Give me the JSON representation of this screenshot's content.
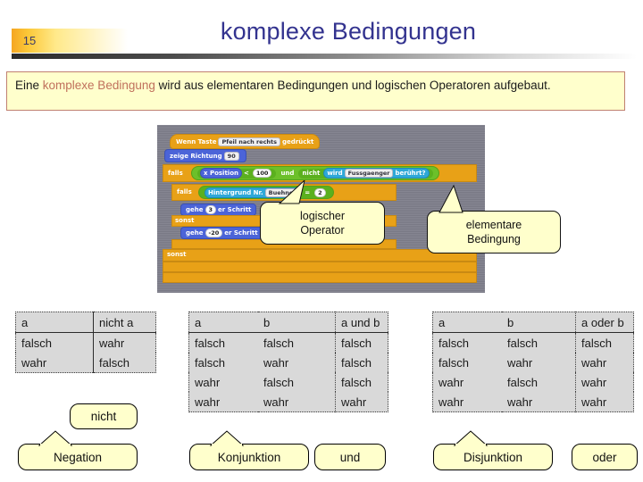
{
  "header": {
    "slide_number": "15",
    "title": "komplexe Bedingungen"
  },
  "definition": {
    "text_before": "Eine ",
    "highlight": "komplexe Bedingung",
    "text_after": " wird aus elementaren Bedingungen und logischen Operatoren aufgebaut.",
    "highlight_color": "#c0705c",
    "background": "#ffffcc",
    "border_color": "#c08070"
  },
  "scratch": {
    "background": "#7f7f8c",
    "blocks": {
      "hat_when": "Wenn Taste",
      "hat_key": "Pfeil nach rechts",
      "hat_pressed": "gedrückt",
      "point_direction": "zeige Richtung",
      "direction_value": "90",
      "if_outer": "falls",
      "x_position": "x Position",
      "less_than": "<",
      "number_100": "100",
      "and_op": "und",
      "not_op": "nicht",
      "touching": "wird",
      "touching_target": "Fussgaenger",
      "touching_end": "berührt?",
      "if_inner": "falls",
      "backdrop_of": "Hintergrund Nr.",
      "backdrop_stage": "Buehne",
      "equals": "=",
      "number_2": "2",
      "move_a": "gehe",
      "move_a_value": "3",
      "move_a_unit": "er Schritt",
      "else_inner": "sonst",
      "move_b": "gehe",
      "move_b_value": "-20",
      "move_b_unit": "er Schritt",
      "else_outer": "sonst"
    }
  },
  "callouts": {
    "logical_operator": [
      "logischer",
      "Operator"
    ],
    "elementary_condition": [
      "elementare",
      "Bedingung"
    ]
  },
  "tables": [
    {
      "name": "negation",
      "headers": [
        "a",
        "nicht a"
      ],
      "rows": [
        [
          "falsch",
          "wahr"
        ],
        [
          "wahr",
          "falsch"
        ]
      ]
    },
    {
      "name": "konjunktion",
      "headers": [
        "a",
        "b",
        "a und b"
      ],
      "rows": [
        [
          "falsch",
          "falsch",
          "falsch"
        ],
        [
          "falsch",
          "wahr",
          "falsch"
        ],
        [
          "wahr",
          "falsch",
          "falsch"
        ],
        [
          "wahr",
          "wahr",
          "wahr"
        ]
      ]
    },
    {
      "name": "disjunktion",
      "headers": [
        "a",
        "b",
        "a oder b"
      ],
      "rows": [
        [
          "falsch",
          "falsch",
          "falsch"
        ],
        [
          "falsch",
          "wahr",
          "wahr"
        ],
        [
          "wahr",
          "falsch",
          "wahr"
        ],
        [
          "wahr",
          "wahr",
          "wahr"
        ]
      ]
    }
  ],
  "labels": {
    "nicht": "nicht",
    "negation": "Negation",
    "konjunktion": "Konjunktion",
    "und": "und",
    "disjunktion": "Disjunktion",
    "oder": "oder"
  }
}
